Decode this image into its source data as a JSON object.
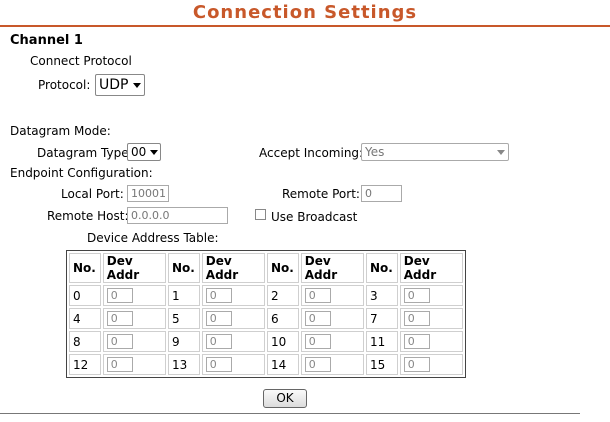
{
  "page": {
    "title": "Connection Settings"
  },
  "channel": {
    "title": "Channel 1"
  },
  "connect_protocol": {
    "heading": "Connect Protocol",
    "protocol_label": "Protocol:",
    "protocol_value": "UDP"
  },
  "datagram": {
    "heading": "Datagram Mode:",
    "type_label": "Datagram Type:",
    "type_value": "00",
    "accept_label": "Accept Incoming:",
    "accept_value": "Yes"
  },
  "endpoint": {
    "heading": "Endpoint Configuration:",
    "local_port_label": "Local Port:",
    "local_port_value": "10001",
    "remote_port_label": "Remote Port:",
    "remote_port_value": "0",
    "remote_host_label": "Remote Host:",
    "remote_host_value": "0.0.0.0",
    "broadcast_label": "Use Broadcast",
    "broadcast_checked": false
  },
  "device_table": {
    "heading": "Device Address Table:",
    "headers": [
      "No.",
      "Dev Addr",
      "No.",
      "Dev Addr",
      "No.",
      "Dev Addr",
      "No.",
      "Dev Addr"
    ],
    "rows": [
      [
        {
          "no": "0",
          "addr": "0"
        },
        {
          "no": "1",
          "addr": "0"
        },
        {
          "no": "2",
          "addr": "0"
        },
        {
          "no": "3",
          "addr": "0"
        }
      ],
      [
        {
          "no": "4",
          "addr": "0"
        },
        {
          "no": "5",
          "addr": "0"
        },
        {
          "no": "6",
          "addr": "0"
        },
        {
          "no": "7",
          "addr": "0"
        }
      ],
      [
        {
          "no": "8",
          "addr": "0"
        },
        {
          "no": "9",
          "addr": "0"
        },
        {
          "no": "10",
          "addr": "0"
        },
        {
          "no": "11",
          "addr": "0"
        }
      ],
      [
        {
          "no": "12",
          "addr": "0"
        },
        {
          "no": "13",
          "addr": "0"
        },
        {
          "no": "14",
          "addr": "0"
        },
        {
          "no": "15",
          "addr": "0"
        }
      ]
    ]
  },
  "ok_button": {
    "label": "OK"
  },
  "colors": {
    "title": "#c8582a",
    "disabled_text": "#777777"
  }
}
